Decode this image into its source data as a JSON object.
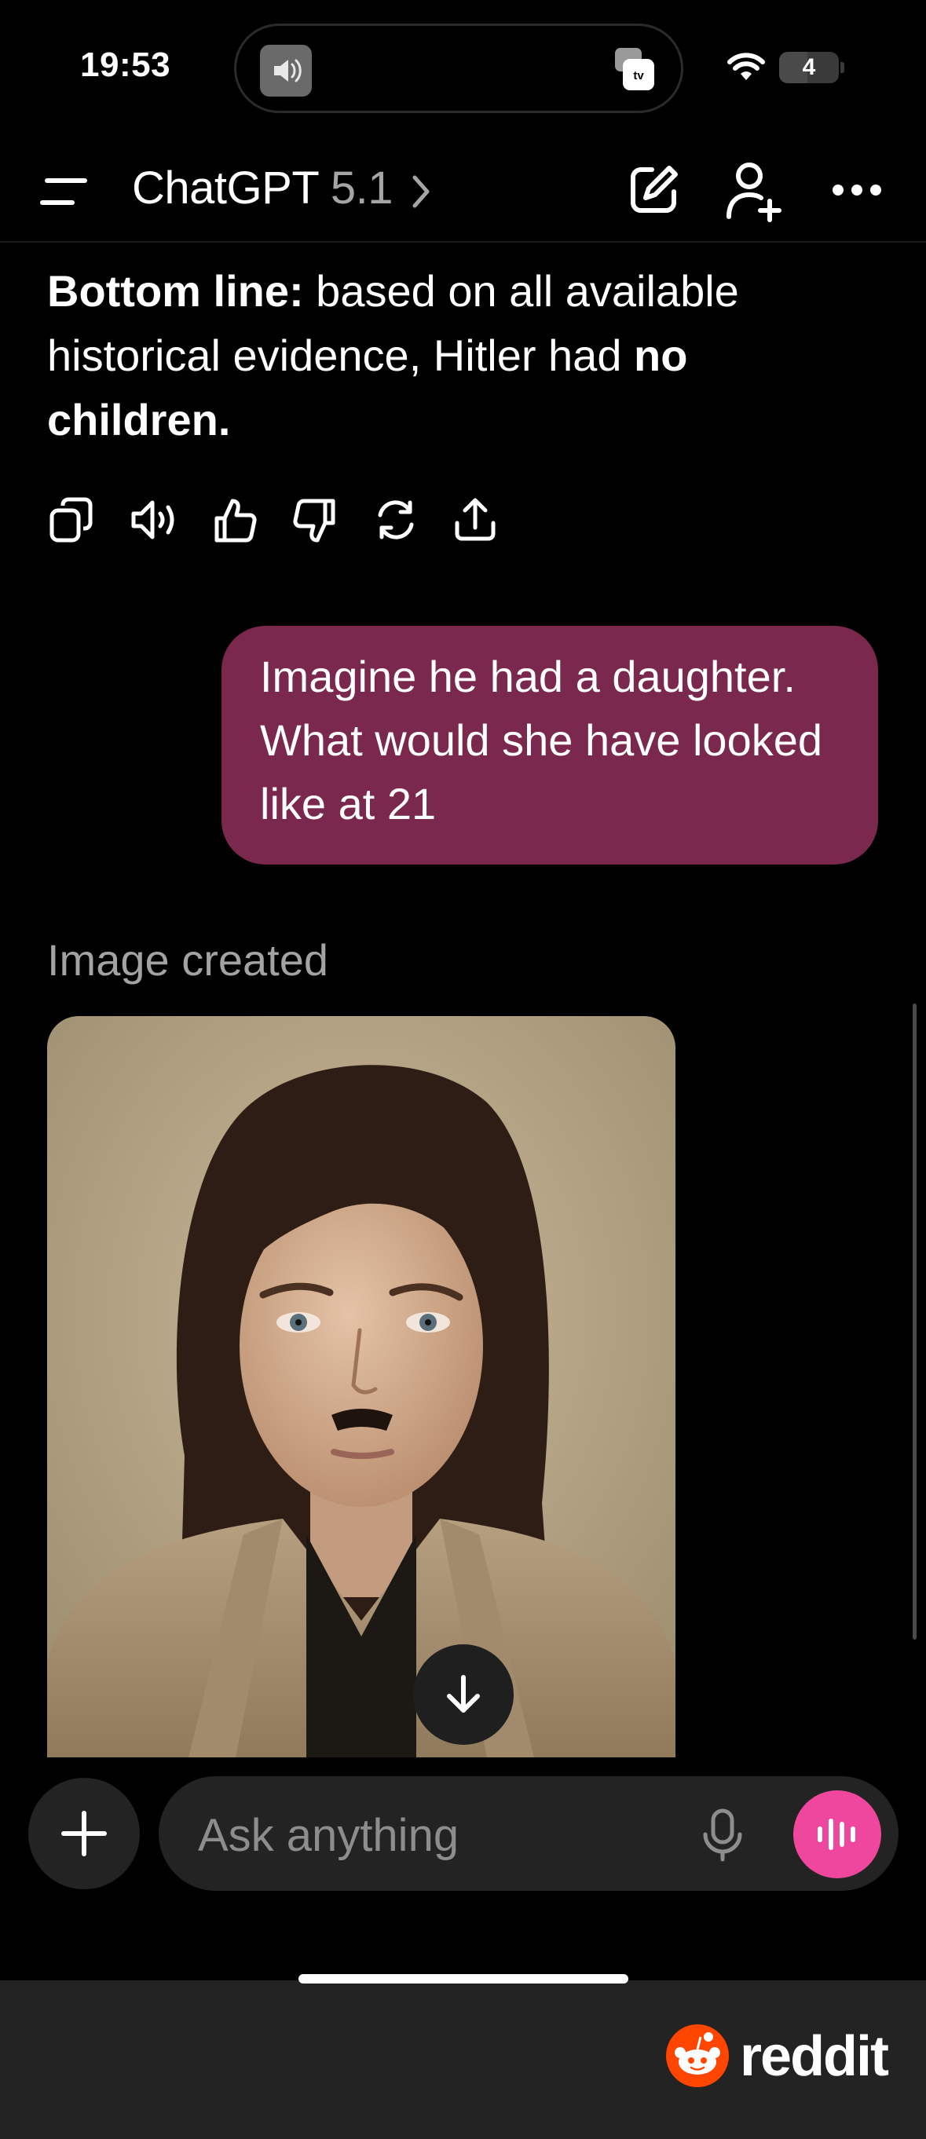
{
  "status_bar": {
    "time": "19:53",
    "battery": "4"
  },
  "header": {
    "app_name": "ChatGPT",
    "model_version": "5.1"
  },
  "assistant_message": {
    "part1_bold": "Bottom line:",
    "part2": " based on all available historical evidence, Hitler had ",
    "part3_bold": "no children."
  },
  "user_message": {
    "text": "Imagine he had a daughter. What would she have looked like at 21"
  },
  "image_label": "Image created",
  "composer": {
    "placeholder": "Ask anything"
  },
  "watermark": {
    "text": "reddit"
  },
  "icons": {
    "actions": [
      "copy-icon",
      "read-aloud-icon",
      "thumbs-up-icon",
      "thumbs-down-icon",
      "regenerate-icon",
      "share-icon"
    ],
    "header": [
      "menu-icon",
      "compose-icon",
      "add-person-icon",
      "more-icon"
    ]
  },
  "colors": {
    "user_bubble": "#7a284d",
    "voice_button": "#f0479e",
    "background": "#000000"
  }
}
